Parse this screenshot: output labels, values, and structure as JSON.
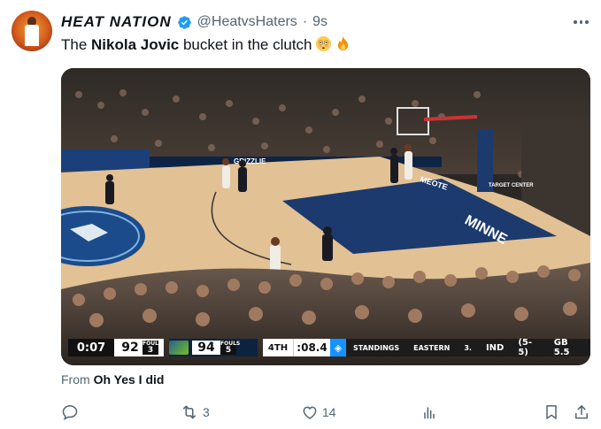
{
  "author": {
    "display_name": "HEAT NATION",
    "handle": "@HeatvsHaters",
    "separator": "·",
    "time": "9s",
    "verified": true,
    "avatar_icon": "avatar-icon"
  },
  "tweet": {
    "text_prefix": "The ",
    "text_bold": "Nikola Jovic",
    "text_suffix": " bucket in the clutch",
    "emojis": [
      "flushed-face-emoji",
      "fire-emoji"
    ]
  },
  "media": {
    "type": "video-frame",
    "scoreboard": {
      "game_clock": "0:07",
      "away_score": "92",
      "away_fouls_label": "FOULS",
      "away_fouls": "3",
      "home_score": "94",
      "home_fouls_label": "FOULS",
      "home_fouls": "5",
      "period": "4TH",
      "shot_clock": ":08.4",
      "standings_label": "STANDINGS",
      "conference": "EASTERN",
      "rank": "3.",
      "team": "IND",
      "record": "(5-5)",
      "games_back": "GB 5.5"
    },
    "court_text": {
      "baseline_left": "GRIZZLIE",
      "paint_word": "MINNE",
      "target_center": "TARGET CENTER",
      "corner_word": "MEOTE"
    }
  },
  "attribution": {
    "prefix": "From ",
    "source": "Oh Yes I did"
  },
  "actions": {
    "reply_count": "",
    "retweet_count": "3",
    "like_count": "14"
  },
  "colors": {
    "text_primary": "#0f1419",
    "text_secondary": "#536471",
    "verified_blue": "#1d9bf0",
    "court_wood": "#e8c9a0",
    "paint_blue": "#1c3a6e"
  }
}
